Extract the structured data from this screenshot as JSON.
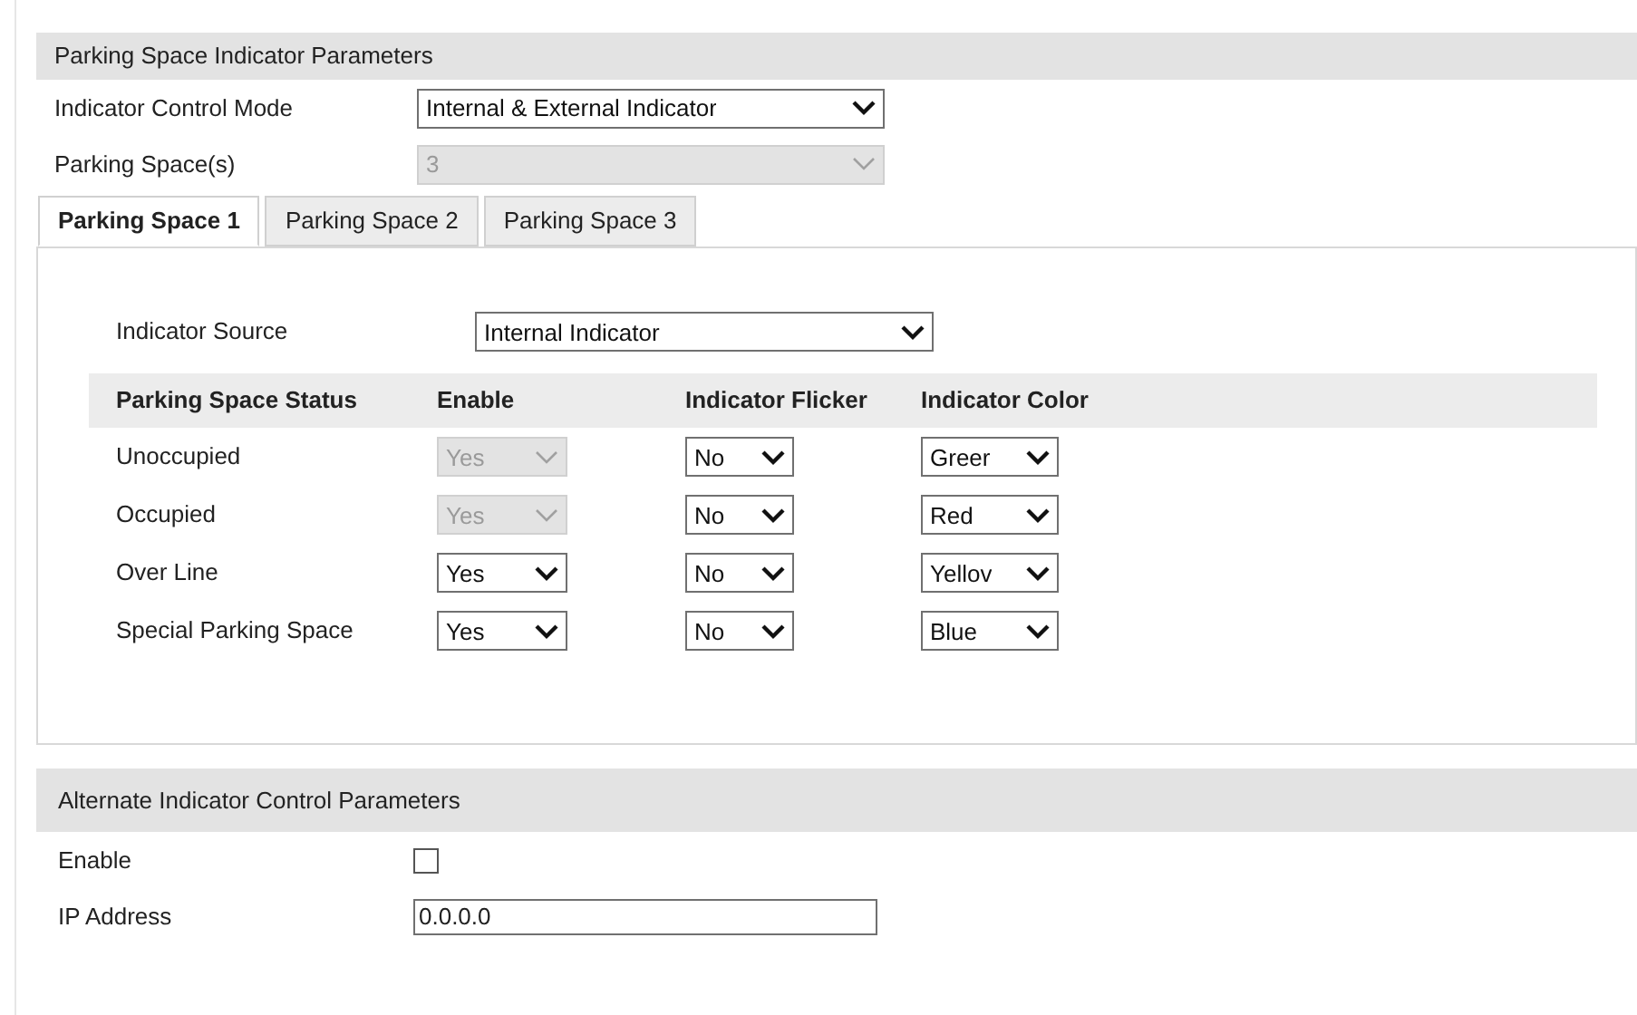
{
  "section_title": "Parking Space Indicator Parameters",
  "control_mode": {
    "label": "Indicator Control Mode",
    "value": "Internal & External Indicator",
    "disabled": false
  },
  "parking_spaces": {
    "label": "Parking Space(s)",
    "value": "3",
    "disabled": true
  },
  "tabs": [
    {
      "label": "Parking Space 1",
      "selected": true
    },
    {
      "label": "Parking Space 2",
      "selected": false
    },
    {
      "label": "Parking Space 3",
      "selected": false
    }
  ],
  "indicator_source": {
    "label": "Indicator Source",
    "value": "Internal Indicator"
  },
  "table": {
    "columns": [
      "Parking Space Status",
      "Enable",
      "Indicator Flicker",
      "Indicator Color"
    ],
    "rows": [
      {
        "status": "Unoccupied",
        "enable": "Yes",
        "enable_disabled": true,
        "flicker": "No",
        "indicator_color": "Greer"
      },
      {
        "status": "Occupied",
        "enable": "Yes",
        "enable_disabled": true,
        "flicker": "No",
        "indicator_color": "Red"
      },
      {
        "status": "Over Line",
        "enable": "Yes",
        "enable_disabled": false,
        "flicker": "No",
        "indicator_color": "Yellov"
      },
      {
        "status": "Special Parking Space",
        "enable": "Yes",
        "enable_disabled": false,
        "flicker": "No",
        "indicator_color": "Blue"
      }
    ]
  },
  "alternate": {
    "title": "Alternate Indicator Control Parameters",
    "enable_label": "Enable",
    "enable_checked": false,
    "ip_label": "IP Address",
    "ip_value": "0.0.0.0"
  }
}
